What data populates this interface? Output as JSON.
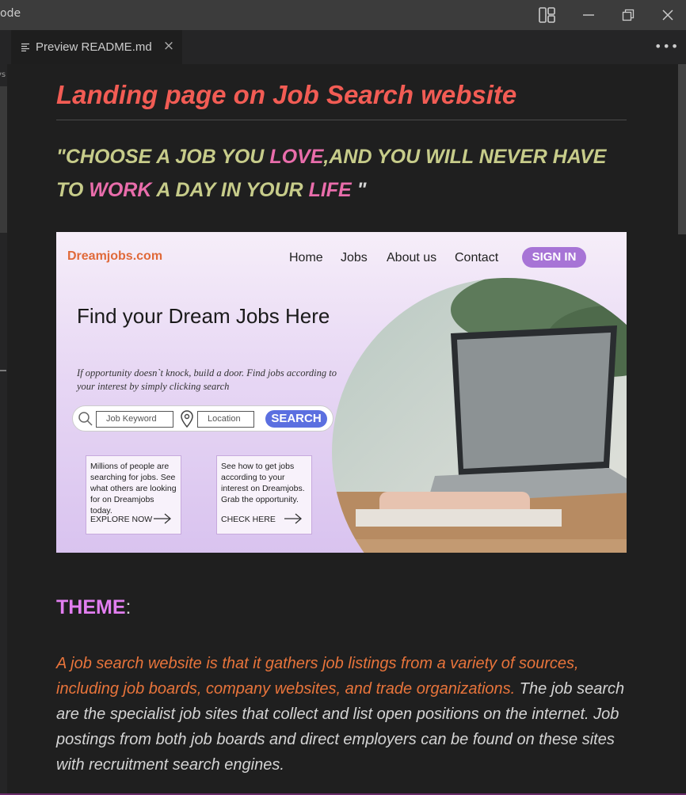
{
  "window": {
    "app_title_fragment": "ode"
  },
  "tabs": [
    {
      "label": "Preview README.md",
      "icon": "preview-lines-icon",
      "close_glyph": "×"
    }
  ],
  "left_group": {
    "text": "vs"
  },
  "colors": {
    "title": "#f25c54",
    "quote": "#c7cc8a",
    "quote_highlight": "#e96dab",
    "theme_heading": "#e27ef0",
    "theme_accent": "#e8743b",
    "signin_button": "#a774d6",
    "search_button": "#5b6fe0",
    "brand": "#e06a3a"
  },
  "readme": {
    "title": "Landing page on Job Search website",
    "quote": {
      "p1": "\"CHOOSE A JOB YOU ",
      "hl1": "LOVE",
      "p2": ",AND YOU WILL NEVER HAVE TO ",
      "hl2": "WORK",
      "p3": " A DAY IN YOUR ",
      "hl3": "LIFE",
      "p4": " \""
    },
    "landing_image": {
      "brand": "Dreamjobs.com",
      "nav": [
        "Home",
        "Jobs",
        "About us",
        "Contact"
      ],
      "signin": "SIGN IN",
      "heading": "Find your Dream Jobs Here",
      "subtext": "If opportunity doesn`t knock, build a door. Find jobs according to your interest by simply clicking search",
      "search": {
        "keyword_placeholder": "Job Keyword",
        "location_placeholder": "Location",
        "button": "SEARCH"
      },
      "cards": [
        {
          "text": "Millions of people are searching for jobs. See what others are looking for on Dreamjobs today.",
          "cta": "EXPLORE NOW"
        },
        {
          "text": "See how to get jobs according to your interest on Dreamjobs. Grab the opportunity.",
          "cta": "CHECK HERE"
        }
      ]
    },
    "theme": {
      "heading": "THEME",
      "colon": ":",
      "accent_text": "A job search website is that it gathers job listings from a variety of sources, including job boards, company websites, and trade organizations.",
      "rest_text": " The job search are the specialist job sites that collect and list open positions on the internet. Job postings from both job boards and direct employers can be found on these sites with recruitment search engines."
    }
  }
}
